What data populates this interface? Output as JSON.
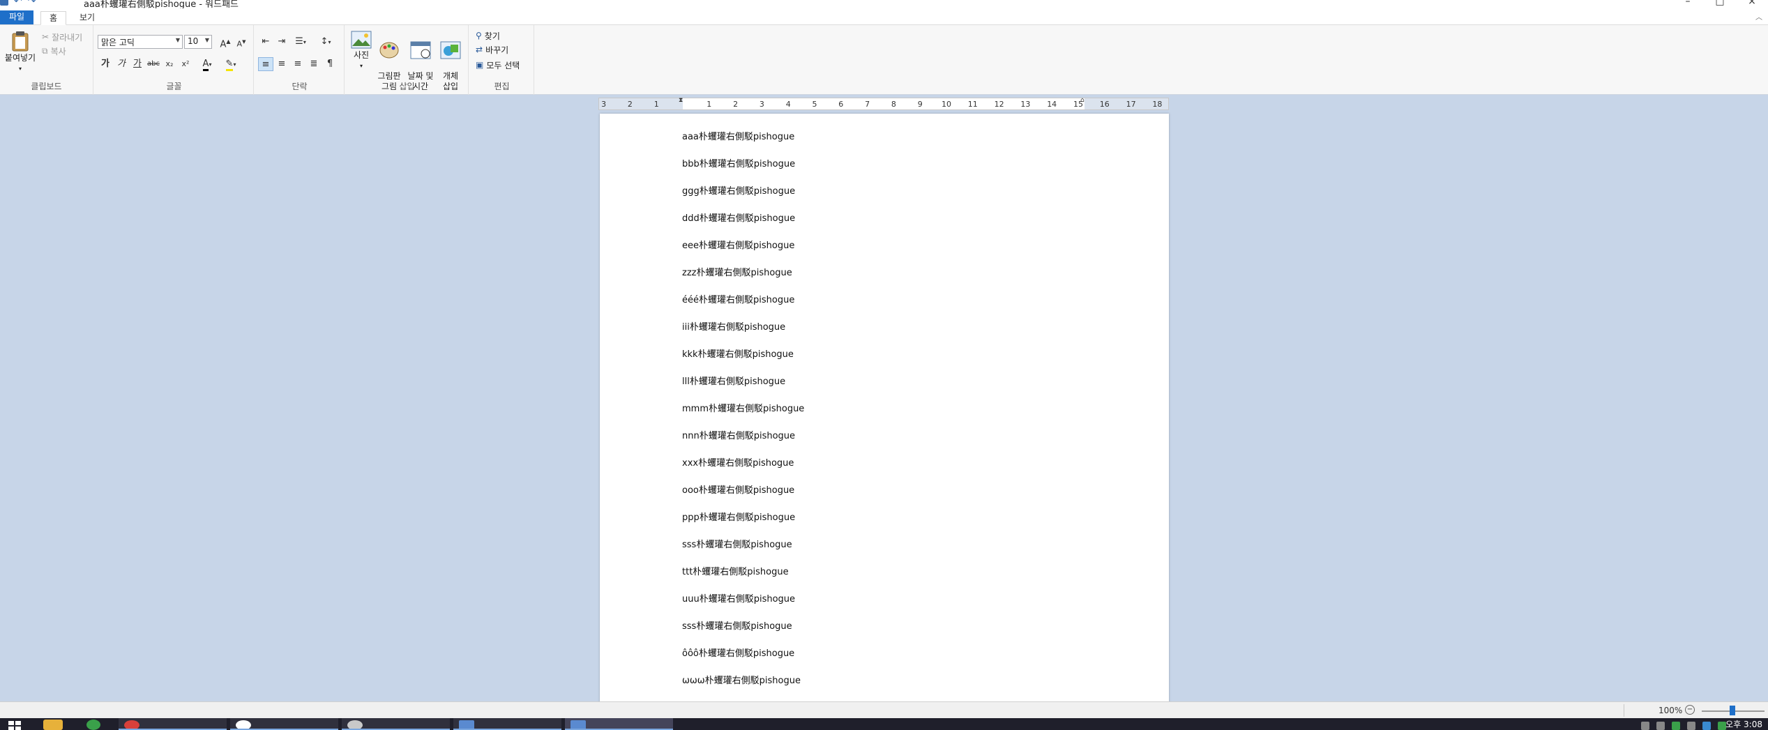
{
  "window": {
    "title": "aaa朴蠼瓘右側駁pishogue - 워드패드"
  },
  "ribbon_tabs": [
    "파일",
    "홈",
    "보기"
  ],
  "clipboard": {
    "paste": "붙여넣기",
    "cut": "잘라내기",
    "copy": "복사",
    "label": "클립보드"
  },
  "font": {
    "family": "맑은 고딕",
    "size": "10",
    "grow": "A",
    "shrink": "A",
    "bold": "가",
    "italic": "가",
    "underline": "가",
    "strike": "abc",
    "subscript": "x₂",
    "superscript": "x²",
    "label": "글꼴"
  },
  "paragraph": {
    "label": "단락"
  },
  "insert": {
    "picture": "사진",
    "paint": "그림판\n그림",
    "datetime": "날짜 및\n시간",
    "object": "개체\n삽입",
    "label": "삽입"
  },
  "editing": {
    "find": "찾기",
    "replace": "바꾸기",
    "select_all": "모두 선택",
    "label": "편집"
  },
  "ruler_ticks": [
    "3",
    "2",
    "1",
    "1",
    "2",
    "3",
    "4",
    "5",
    "6",
    "7",
    "8",
    "9",
    "10",
    "11",
    "12",
    "13",
    "14",
    "15",
    "16",
    "17",
    "18"
  ],
  "document_lines": [
    "aaa朴蠼瓘右側駁pishogue",
    "bbb朴蠼瓘右側駁pishogue",
    "ggg朴蠼瓘右側駁pishogue",
    "ddd朴蠼瓘右側駁pishogue",
    "eee朴蠼瓘右側駁pishogue",
    "zzz朴蠼瓘右側駁pishogue",
    "ééé朴蠼瓘右側駁pishogue",
    "iii朴蠼瓘右側駁pishogue",
    "kkk朴蠼瓘右側駁pishogue",
    "lll朴蠼瓘右側駁pishogue",
    "mmm朴蠼瓘右側駁pishogue",
    "nnn朴蠼瓘右側駁pishogue",
    "xxx朴蠼瓘右側駁pishogue",
    "ooo朴蠼瓘右側駁pishogue",
    "ppp朴蠼瓘右側駁pishogue",
    "sss朴蠼瓘右側駁pishogue",
    "ttt朴蠼瓘右側駁pishogue",
    "uuu朴蠼瓘右側駁pishogue",
    "sss朴蠼瓘右側駁pishogue",
    "ôôô朴蠼瓘右側駁pishogue",
    "ωωω朴蠼瓘右側駁pishogue"
  ],
  "status": {
    "zoom": "100%",
    "zoom_level": 1.0
  },
  "taskbar": {
    "clock": "오후 3:08"
  },
  "colors": {
    "accent": "#1e6fc9",
    "workspace": "#c7d5e8",
    "taskbar": "#1f1f2b"
  }
}
